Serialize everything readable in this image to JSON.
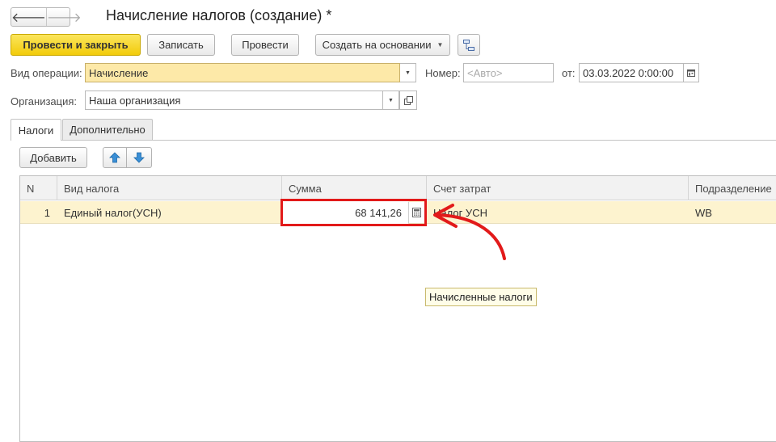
{
  "window": {
    "title": "Начисление налогов (создание) *"
  },
  "nav": {
    "back_icon": "arrow-left",
    "forward_icon": "arrow-right",
    "back_glyph": "🡐",
    "forward_glyph": "🡒"
  },
  "toolbar": {
    "post_close": "Провести и закрыть",
    "save": "Записать",
    "post": "Провести",
    "create_based_on": "Создать на основании",
    "structure_icon": "structure-icon"
  },
  "form": {
    "operation_label": "Вид операции:",
    "operation_value": "Начисление",
    "number_label": "Номер:",
    "number_placeholder": "<Авто>",
    "date_label": "от:",
    "date_value": "03.03.2022  0:00:00",
    "org_label": "Организация:",
    "org_value": "Наша организация"
  },
  "tabs": [
    {
      "label": "Налоги",
      "active": true
    },
    {
      "label": "Дополнительно",
      "active": false
    }
  ],
  "table_toolbar": {
    "add": "Добавить",
    "up_icon": "arrow-up-icon",
    "down_icon": "arrow-down-icon"
  },
  "table": {
    "columns": [
      "N",
      "Вид налога",
      "Сумма",
      "Счет затрат",
      "Подразделение"
    ],
    "rows": [
      {
        "n": "1",
        "tax_type": "Единый налог(УСН)",
        "amount": "68 141,26",
        "cost_account": "Налог УСН",
        "department": "WB"
      }
    ]
  },
  "tooltip": "Начисленные налоги",
  "colors": {
    "primary_button": "#f5d31c",
    "selected_row": "#fdf3cf",
    "highlight": "#e21a1a",
    "field_yellow": "#fde9a8"
  }
}
